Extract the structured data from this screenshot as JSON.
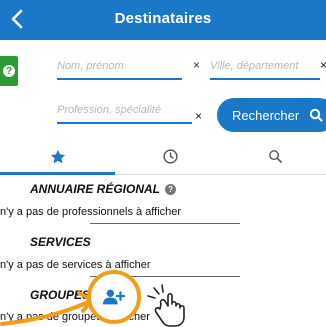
{
  "header": {
    "title": "Destinataires",
    "back_icon": "chevron-left-icon"
  },
  "search": {
    "name_placeholder": "Nom, prénom",
    "city_placeholder": "Ville, département",
    "profession_placeholder": "Profession, spécialité",
    "clear_label": "×",
    "search_button_label": "Rechercher"
  },
  "tabs": [
    {
      "icon": "star-icon",
      "active": true
    },
    {
      "icon": "clock-icon",
      "active": false
    },
    {
      "icon": "search-icon",
      "active": false
    }
  ],
  "sections": [
    {
      "title": "ANNUAIRE RÉGIONAL",
      "message": "n'y a pas de professionnels à afficher"
    },
    {
      "title": "SERVICES",
      "message": "n'y a pas de services à afficher"
    },
    {
      "title": "GROUPES",
      "message": "n'y a pas de groupes à afficher"
    }
  ],
  "overlay": {
    "icon": "add-user-icon",
    "pointer_icon": "hand-pointer-icon",
    "ring_color": "#f29d1a"
  },
  "colors": {
    "primary": "#1b78c8",
    "help_green": "#2f9a3c",
    "accent_orange": "#f29d1a"
  }
}
